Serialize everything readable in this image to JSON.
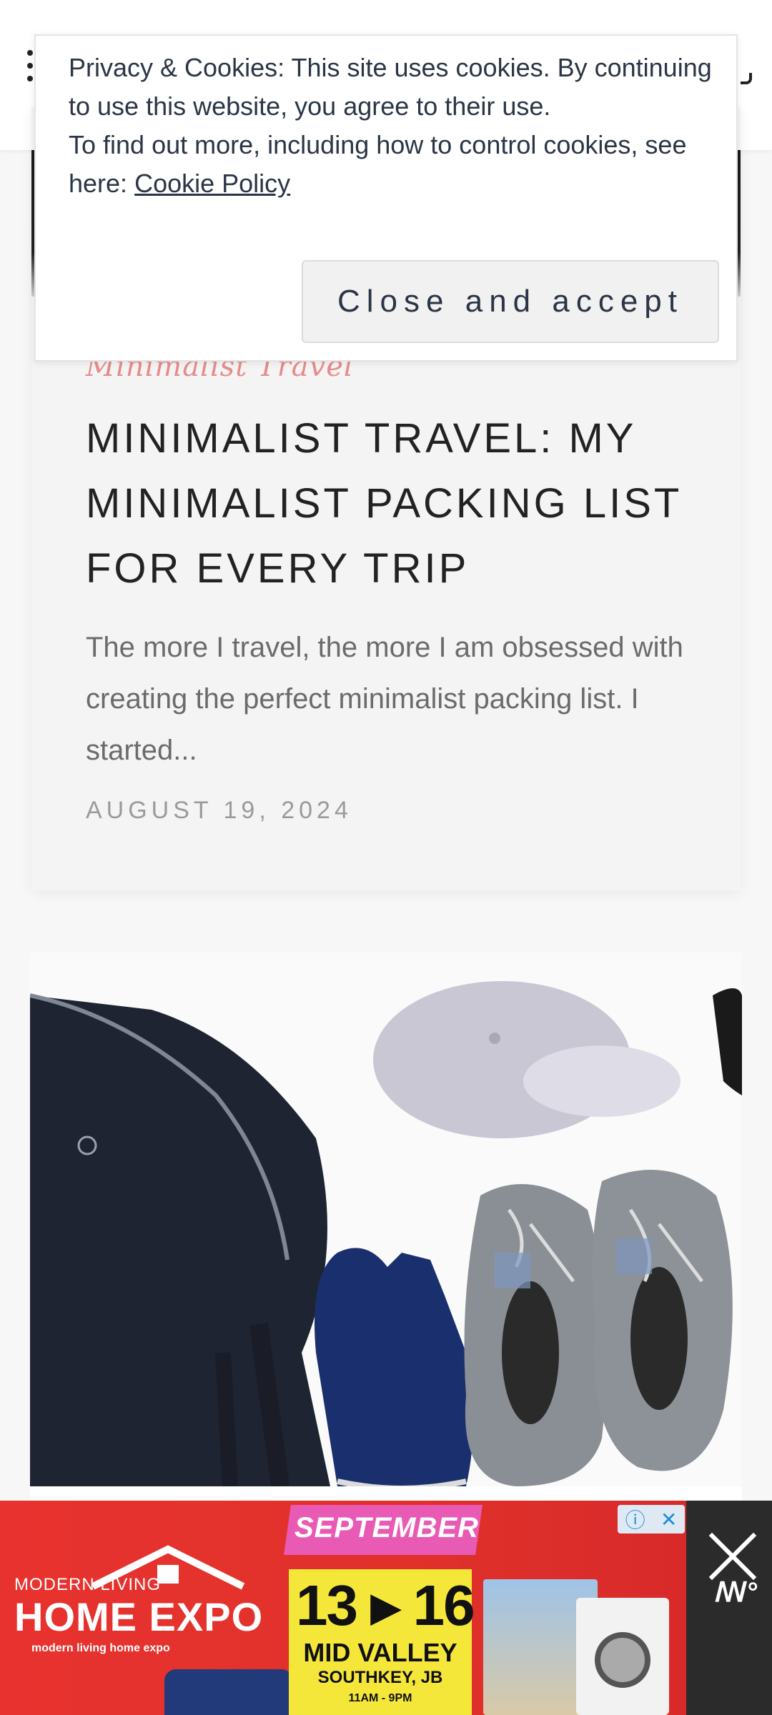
{
  "cookie": {
    "line1": "Privacy & Cookies: This site uses cookies. By continuing to use this website, you agree to their use.",
    "line2": "To find out more, including how to control cookies, see here:",
    "link": "Cookie Policy",
    "button": "Close and accept"
  },
  "post": {
    "category": "Minimalist Travel",
    "title": "MINIMALIST TRAVEL: MY MINIMALIST PACKING LIST FOR EVERY TRIP",
    "excerpt": "The more I travel, the more I am obsessed with creating the perfect minimalist packing list. I started...",
    "date": "AUGUST 19, 2024"
  },
  "ad": {
    "brand_small": "MODERN LIVING",
    "brand_big": "HOME EXPO",
    "social": "modern living home expo",
    "month": "SEPTEMBER",
    "dates": "13 ▸ 16",
    "venue": "MID VALLEY",
    "city": "SOUTHKEY, JB",
    "hours": "11AM - 9PM",
    "info_icon": "info-icon",
    "close_icon": "close-icon"
  }
}
